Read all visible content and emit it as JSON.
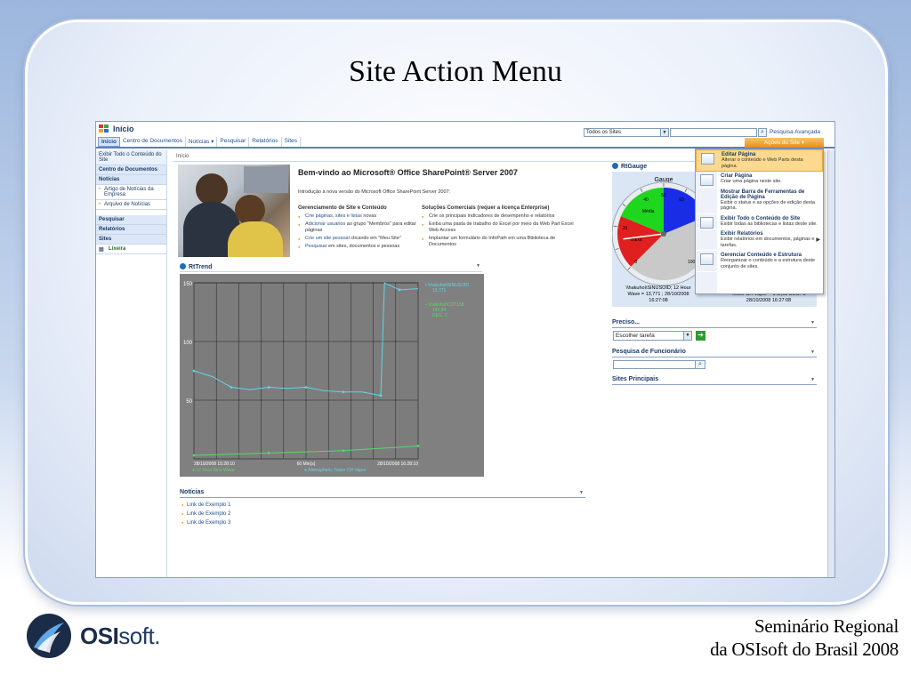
{
  "slide": {
    "title": "Site Action Menu",
    "footer_line1": "Seminário Regional",
    "footer_line2": "da OSIsoft do Brasil 2008",
    "logo_bold": "OSI",
    "logo_light": "soft."
  },
  "sp": {
    "site_title": "Início",
    "nav": [
      "Início",
      "Centro de Documentos",
      "Notícias ▾",
      "Pesquisar",
      "Relatórios",
      "Sites"
    ],
    "scope_value": "Todos os Sites",
    "search_placeholder": "",
    "advanced_search": "Pesquisa Avançada",
    "site_actions": "Ações do Site ▾",
    "breadcrumb": "Início",
    "left_nav": {
      "view_all": "Exibir Todo o Conteúdo do Site",
      "docs": "Centro de Documentos",
      "news": "Notícias",
      "news_items": [
        "Artigo de Notícias da Empresa",
        "Arquivo de Notícias"
      ],
      "search": "Pesquisar",
      "reports": "Relatórios",
      "sites": "Sites",
      "recycle": "Lixeira"
    },
    "welcome_title": "Bem-vindo ao Microsoft® Office SharePoint® Server 2007",
    "intro": "Introdução à nova versão do Microsoft Office SharePoint Server 2007:",
    "col1": {
      "head": "Gerenciamento de Site e Conteúdo",
      "i1_link": "Crie páginas, sites e listas",
      "i1_text": " novas",
      "i2_link": "Adicionar usuários",
      "i2_text": " ao grupo \"Membros\" para editar páginas",
      "i3_link": "Crie um site pessoal",
      "i3_text": " clicando em \"Meu Site\"",
      "i4_link": "Pesquisar",
      "i4_text": " em sites, documentos e pessoas"
    },
    "col2": {
      "head": "Soluções Comerciais (requer a licença Enterprise)",
      "i1": "Crie os principais indicadores de desempenho e relatórios",
      "i2": "Exiba uma pasta de trabalho do Excel por meio da Web Part Excel Web Access",
      "i3": "Implantar um formulário do InfoPath em uma Biblioteca de Documentos"
    },
    "trend_title": "RtTrend",
    "gauge_title": "RtGauge",
    "gauge_label": "Gauge",
    "gauge_caption1a": "\\\\hakuhoi\\SINUSOID; 12 Hour",
    "gauge_caption1b": "Wave = 13,771 ; 28/10/2008",
    "gauge_caption1c": "16:27:08",
    "gauge_caption2a": "Tower CH Vapor = 142,93 DEG. C",
    "gauge_caption2b": "28/10/2008 16:27:08",
    "preciso": "Preciso...",
    "task_select": "Escolher tarefa",
    "employee_search": "Pesquisa de Funcionário",
    "main_sites": "Sites Principais",
    "news_title": "Notícias",
    "news_links": [
      "Link de Exemplo 1",
      "Link de Exemplo 2",
      "Link de Exemplo 3"
    ],
    "menu": [
      {
        "title": "Editar Página",
        "desc": "Alterar o conteúdo e Web Parts desta página."
      },
      {
        "title": "Criar Página",
        "desc": "Criar uma página neste site."
      },
      {
        "title": "Mostrar Barra de Ferramentas de Edição de Página",
        "desc": "Exibir o status e as opções de edição desta página."
      },
      {
        "title": "Exibir Todo o Conteúdo do Site",
        "desc": "Exibir todas as bibliotecas e listas deste site."
      },
      {
        "title": "Exibir Relatórios",
        "desc": "Exibir relatórios em documentos, páginas e tarefas."
      },
      {
        "title": "Gerenciar Conteúdo e Estrutura",
        "desc": "Reorganizar o conteúdo e a estrutura deste conjunto de sites."
      }
    ]
  },
  "chart_data": [
    {
      "type": "line",
      "title": "RtTrend",
      "xlabel": "60 Min(s)",
      "x_start": "28/10/2008 15:28:10",
      "x_end": "28/10/2008 16:28:10",
      "ylim": [
        0,
        150
      ],
      "yticks": [
        50,
        100,
        150
      ],
      "grid": true,
      "background": "#808080",
      "series": [
        {
          "name": "12 Hour Sine Wave",
          "color": "#5ad86a",
          "x": [
            0,
            10,
            20,
            30,
            40,
            50,
            60
          ],
          "values": [
            3,
            4,
            5,
            6,
            7,
            9,
            11
          ]
        },
        {
          "name": "Atmospheric Tower CH Vapor",
          "color": "#5fd7e6",
          "x": [
            0,
            5,
            10,
            15,
            20,
            25,
            30,
            35,
            40,
            45,
            50,
            51,
            55,
            60
          ],
          "values": [
            75,
            70,
            61,
            59,
            61,
            60,
            61,
            58,
            57,
            57,
            54,
            150,
            144,
            145
          ]
        }
      ],
      "legend": [
        {
          "label": "\\\\hakuhoi\\SINUSOID",
          "value": "13,771"
        },
        {
          "label": "\\\\hakuhoi\\CDT158",
          "value": "142,94",
          "unit": "DEG. C"
        }
      ]
    },
    {
      "type": "gauge",
      "title": "Gauge",
      "range": [
        0,
        100
      ],
      "ticks": [
        0,
        10,
        20,
        30,
        40,
        50,
        60,
        70,
        80,
        90,
        100
      ],
      "bands": [
        {
          "name": "Baixa",
          "from": 0,
          "to": 25,
          "color": "#e02020"
        },
        {
          "name": "Média",
          "from": 25,
          "to": 50,
          "color": "#1fd61f"
        },
        {
          "name": "",
          "from": 50,
          "to": 75,
          "color": "#1a2de6"
        }
      ],
      "value": 14
    }
  ]
}
